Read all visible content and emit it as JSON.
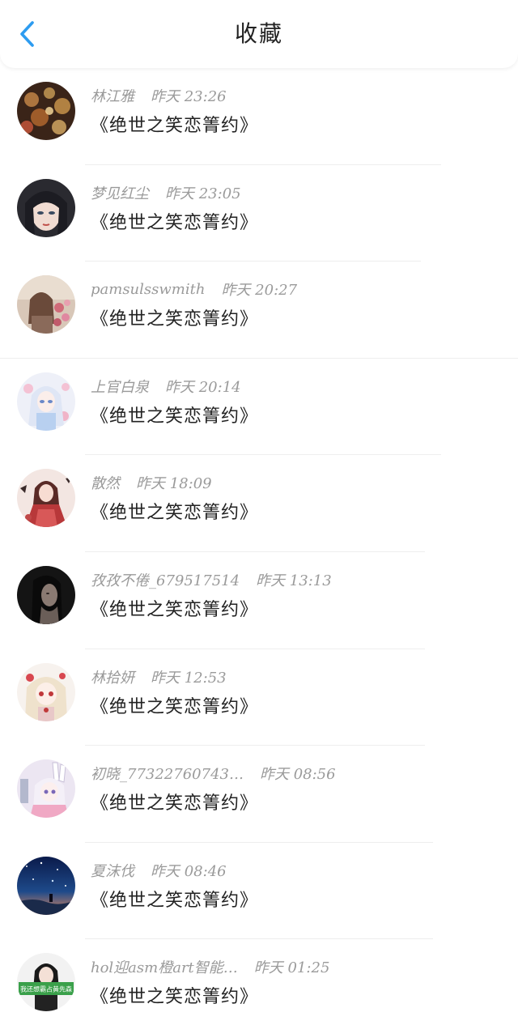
{
  "header": {
    "title": "收藏",
    "back_icon": "chevron-left-icon",
    "accent_color": "#2d9cf0"
  },
  "items": [
    {
      "name": "林江雅",
      "time": "昨天 23:26",
      "title": "《绝世之笑恋箐约》",
      "avatar_icon": "avatar-bokeh-lights"
    },
    {
      "name": "梦见红尘",
      "time": "昨天 23:05",
      "title": "《绝世之笑恋箐约》",
      "avatar_icon": "avatar-anime-girl-dark-hair"
    },
    {
      "name": "pamsulsswmith",
      "time": "昨天 20:27",
      "title": "《绝世之笑恋箐约》",
      "avatar_icon": "avatar-girl-with-flowers"
    },
    {
      "name": "上官白泉",
      "time": "昨天 20:14",
      "title": "《绝世之笑恋箐约》",
      "avatar_icon": "avatar-anime-girl-white-hair"
    },
    {
      "name": "散然",
      "time": "昨天 18:09",
      "title": "《绝世之笑恋箐约》",
      "avatar_icon": "avatar-anime-girl-red-dress"
    },
    {
      "name": "孜孜不倦_679517514",
      "time": "昨天 13:13",
      "title": "《绝世之笑恋箐约》",
      "avatar_icon": "avatar-woman-dark-portrait"
    },
    {
      "name": "林拾妍",
      "time": "昨天 12:53",
      "title": "《绝世之笑恋箐约》",
      "avatar_icon": "avatar-anime-girl-blonde"
    },
    {
      "name": "初晓_77322760743…",
      "time": "昨天 08:56",
      "title": "《绝世之笑恋箐约》",
      "avatar_icon": "avatar-anime-girl-bunny-ears"
    },
    {
      "name": "夏沫伐",
      "time": "昨天 08:46",
      "title": "《绝世之笑恋箐约》",
      "avatar_icon": "avatar-starry-night"
    },
    {
      "name": "hol迎asm橙art智能…",
      "time": "昨天 01:25",
      "title": "《绝世之笑恋箐约》",
      "avatar_icon": "avatar-woman-with-sign",
      "avatar_text": "我还想霸占黄先森"
    }
  ]
}
